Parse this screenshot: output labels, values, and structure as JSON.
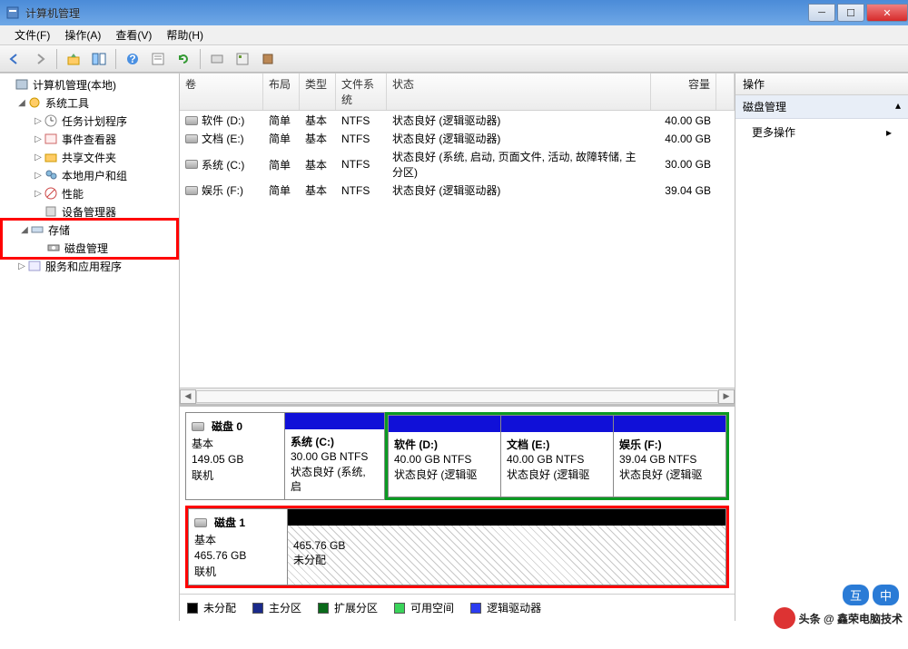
{
  "window": {
    "title": "计算机管理"
  },
  "menu": {
    "file": "文件(F)",
    "action": "操作(A)",
    "view": "查看(V)",
    "help": "帮助(H)"
  },
  "tree": {
    "root": "计算机管理(本地)",
    "systools": "系统工具",
    "task_sched": "任务计划程序",
    "event_viewer": "事件查看器",
    "shared": "共享文件夹",
    "users": "本地用户和组",
    "perf": "性能",
    "devmgr": "设备管理器",
    "storage": "存储",
    "diskmgmt": "磁盘管理",
    "services": "服务和应用程序"
  },
  "vol_headers": {
    "vol": "卷",
    "layout": "布局",
    "type": "类型",
    "fs": "文件系统",
    "status": "状态",
    "capacity": "容量"
  },
  "volumes": [
    {
      "name": "软件 (D:)",
      "layout": "简单",
      "type": "基本",
      "fs": "NTFS",
      "status": "状态良好 (逻辑驱动器)",
      "capacity": "40.00 GB"
    },
    {
      "name": "文档 (E:)",
      "layout": "简单",
      "type": "基本",
      "fs": "NTFS",
      "status": "状态良好 (逻辑驱动器)",
      "capacity": "40.00 GB"
    },
    {
      "name": "系统 (C:)",
      "layout": "简单",
      "type": "基本",
      "fs": "NTFS",
      "status": "状态良好 (系统, 启动, 页面文件, 活动, 故障转储, 主分区)",
      "capacity": "30.00 GB"
    },
    {
      "name": "娱乐 (F:)",
      "layout": "简单",
      "type": "基本",
      "fs": "NTFS",
      "status": "状态良好 (逻辑驱动器)",
      "capacity": "39.04 GB"
    }
  ],
  "disk0": {
    "title": "磁盘 0",
    "type": "基本",
    "size": "149.05 GB",
    "status": "联机",
    "p0": {
      "name": "系统  (C:)",
      "size": "30.00 GB NTFS",
      "status": "状态良好 (系统, 启"
    },
    "p1": {
      "name": "软件  (D:)",
      "size": "40.00 GB NTFS",
      "status": "状态良好 (逻辑驱"
    },
    "p2": {
      "name": "文档  (E:)",
      "size": "40.00 GB NTFS",
      "status": "状态良好 (逻辑驱"
    },
    "p3": {
      "name": "娱乐  (F:)",
      "size": "39.04 GB NTFS",
      "status": "状态良好 (逻辑驱"
    }
  },
  "disk1": {
    "title": "磁盘 1",
    "type": "基本",
    "size": "465.76 GB",
    "status": "联机",
    "unalloc_size": "465.76 GB",
    "unalloc_label": "未分配"
  },
  "legend": {
    "unalloc": "未分配",
    "primary": "主分区",
    "extended": "扩展分区",
    "free": "可用空间",
    "logical": "逻辑驱动器"
  },
  "actions": {
    "header": "操作",
    "diskmgmt": "磁盘管理",
    "more": "更多操作"
  },
  "watermark": "头条 @ 鑫荣电脑技术",
  "pill1": "互",
  "pill2": "中"
}
